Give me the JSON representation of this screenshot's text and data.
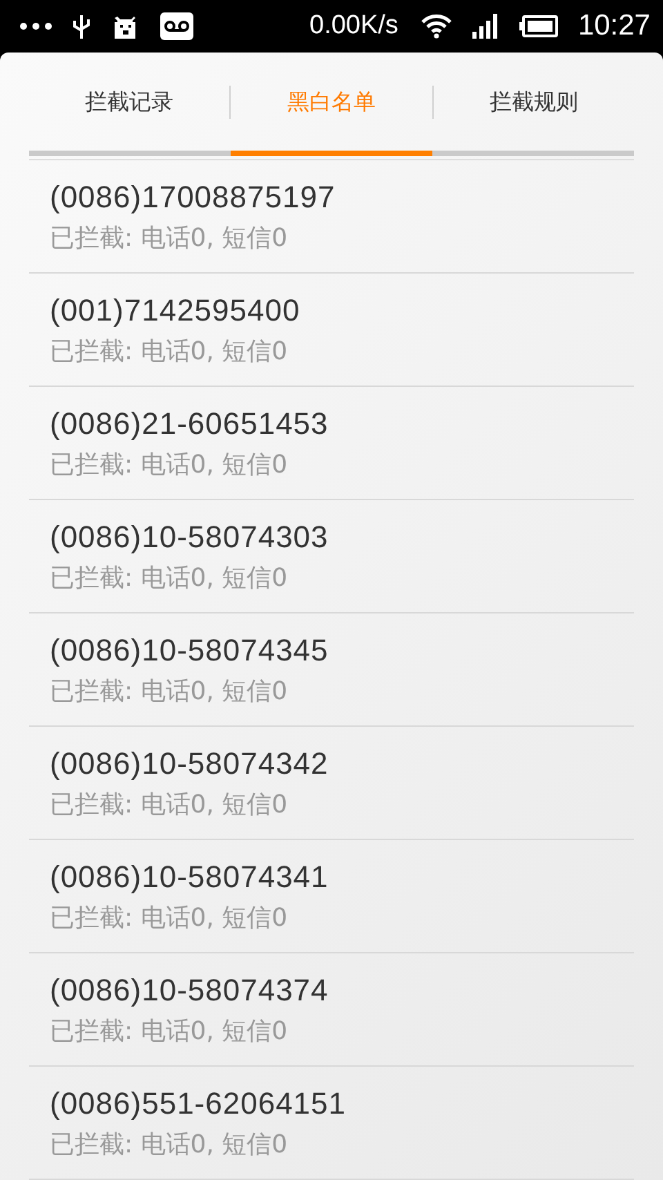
{
  "status_bar": {
    "speed": "0.00K/s",
    "time": "10:27"
  },
  "tabs": [
    {
      "label": "拦截记录",
      "selected": false
    },
    {
      "label": "黑白名单",
      "selected": true
    },
    {
      "label": "拦截规则",
      "selected": false
    }
  ],
  "list": [
    {
      "number": "(0086)17008875197",
      "summary": "已拦截: 电话0, 短信0"
    },
    {
      "number": "(001)7142595400",
      "summary": "已拦截: 电话0, 短信0"
    },
    {
      "number": "(0086)21-60651453",
      "summary": "已拦截: 电话0, 短信0"
    },
    {
      "number": "(0086)10-58074303",
      "summary": "已拦截: 电话0, 短信0"
    },
    {
      "number": "(0086)10-58074345",
      "summary": "已拦截: 电话0, 短信0"
    },
    {
      "number": "(0086)10-58074342",
      "summary": "已拦截: 电话0, 短信0"
    },
    {
      "number": "(0086)10-58074341",
      "summary": "已拦截: 电话0, 短信0"
    },
    {
      "number": "(0086)10-58074374",
      "summary": "已拦截: 电话0, 短信0"
    },
    {
      "number": "(0086)551-62064151",
      "summary": "已拦截: 电话0, 短信0"
    }
  ]
}
